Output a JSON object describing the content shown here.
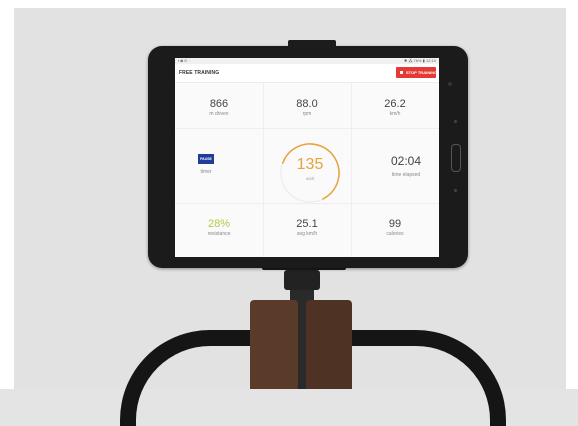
{
  "status": {
    "left": "▪ ◙ ⊙ ·",
    "right": "✱ ⁂ 76% ▮ 12:10"
  },
  "app": {
    "title": "FREE TRAINING",
    "stop_label": "STOP TRAINING"
  },
  "metrics": {
    "meters": {
      "value": "866",
      "label": "m driven"
    },
    "rpm": {
      "value": "88.0",
      "label": "rpm"
    },
    "speed": {
      "value": "26.2",
      "label": "km/h"
    },
    "pause_label": "PAUSE",
    "timer_label": "timer",
    "watt": {
      "value": "135",
      "label": "watt"
    },
    "time": {
      "value": "02:04",
      "label": "time elapsed"
    },
    "resistance": {
      "value": "28%",
      "label": "resistance"
    },
    "avg_speed": {
      "value": "25.1",
      "label": "avg km/h"
    },
    "calories": {
      "value": "99",
      "label": "calories"
    }
  },
  "colors": {
    "stop": "#e53935",
    "pause": "#1f3d99",
    "gauge": "#e8a33c",
    "resistance": "#b6c94a"
  },
  "gauge_fraction": 0.62
}
